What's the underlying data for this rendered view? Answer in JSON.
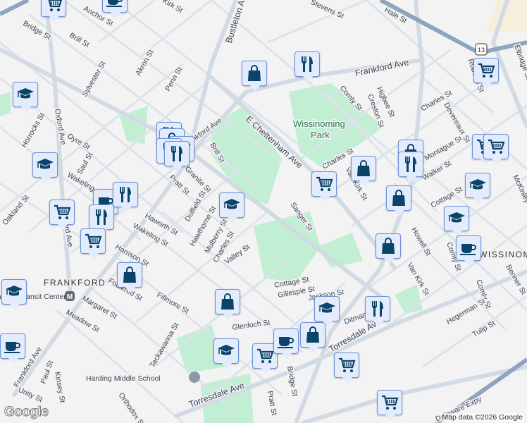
{
  "map": {
    "attribution": "Map data ©2026 Google",
    "logo": "Google",
    "colors": {
      "land": "#f4f3f4",
      "road": "#d6dee6",
      "park": "#c2efd3",
      "highway": "#8ea4bf",
      "marker_bg": "#e3ecfc",
      "marker_border": "#6d92d8",
      "icon": "#0b4468"
    },
    "area_labels": [
      "FRANKFORD",
      "WISSINOMING"
    ],
    "park_labels": [
      "Wissinoming",
      "Park"
    ],
    "school_label": "Harding Middle School",
    "transit_label": "Frankford Transit Center",
    "route_shield": "13",
    "streets": [
      "Frankford Ave",
      "Bustleton Ave",
      "E Cheltenham Ave",
      "Oxford Ave",
      "Torresdale Ave",
      "Anchor St",
      "Bridge St",
      "Brill St",
      "Sylvester St",
      "Akron St",
      "Penn St",
      "Horrocks St",
      "Dyre St",
      "Saul St",
      "Wakeling St",
      "Pratt St",
      "Granite St",
      "Duffield St",
      "Haworth St",
      "Hawthorne St",
      "Mulberry St",
      "Charles St",
      "Valley St",
      "Harrison St",
      "Foulkrod St",
      "Margaret St",
      "Meadow St",
      "Fillmore St",
      "Tackawanna St",
      "Glenloch St",
      "Kinsey St",
      "Paul St",
      "Unity St",
      "Orthodox St",
      "Oakland St",
      "Comly St",
      "Creston St",
      "Higbee St",
      "Hale St",
      "Stevens St",
      "Devereaux St",
      "Montague St",
      "Walker St",
      "Van Kirk St",
      "Sanger St",
      "Cottage St",
      "Gillespie St",
      "Jackson St",
      "Ditman St",
      "Howell St",
      "Hegerman St",
      "Tulip St",
      "Benner St",
      "McKinley St",
      "Delaware Expy",
      "Roberts St",
      "Elbridge St",
      "Kirk St",
      "Bridge St",
      "Cottage St"
    ],
    "markers": [
      {
        "type": "cart"
      },
      {
        "type": "coffee"
      },
      {
        "type": "bag"
      },
      {
        "type": "restaurant"
      },
      {
        "type": "school"
      },
      {
        "type": "school"
      },
      {
        "type": "restaurant"
      },
      {
        "type": "bag"
      },
      {
        "type": "cart"
      },
      {
        "type": "restaurant"
      },
      {
        "type": "restaurant"
      },
      {
        "type": "school"
      },
      {
        "type": "cart"
      },
      {
        "type": "coffee"
      },
      {
        "type": "restaurant"
      },
      {
        "type": "restaurant"
      },
      {
        "type": "cart"
      },
      {
        "type": "bag"
      },
      {
        "type": "school"
      },
      {
        "type": "coffee"
      },
      {
        "type": "bag"
      },
      {
        "type": "school"
      },
      {
        "type": "cart"
      },
      {
        "type": "coffee"
      },
      {
        "type": "bag"
      },
      {
        "type": "school"
      },
      {
        "type": "restaurant"
      },
      {
        "type": "cart"
      },
      {
        "type": "cart"
      },
      {
        "type": "cart"
      },
      {
        "type": "bag"
      },
      {
        "type": "bag"
      },
      {
        "type": "restaurant"
      },
      {
        "type": "bag"
      },
      {
        "type": "bag"
      },
      {
        "type": "cart"
      },
      {
        "type": "cart"
      },
      {
        "type": "school"
      },
      {
        "type": "school"
      },
      {
        "type": "coffee"
      },
      {
        "type": "cart"
      }
    ]
  }
}
